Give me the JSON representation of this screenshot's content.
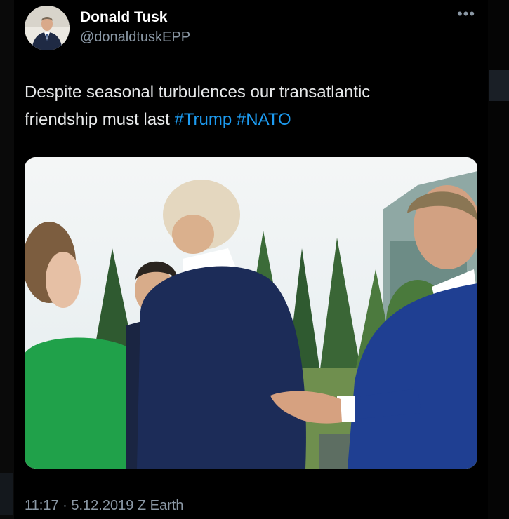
{
  "tweet": {
    "author_name": "Donald Tusk",
    "author_handle": "@donaldtuskEPP",
    "more_icon": "more-dots-icon",
    "text_plain": "Despite seasonal turbulences our transatlantic friendship must last ",
    "hashtags": [
      "#Trump",
      "#NATO"
    ],
    "timestamp": "11:17 · 5.12.2019 Z Earth"
  },
  "colors": {
    "background": "#000000",
    "text": "#e7e9ea",
    "secondary": "#8b98a5",
    "link": "#1d9bf0"
  }
}
